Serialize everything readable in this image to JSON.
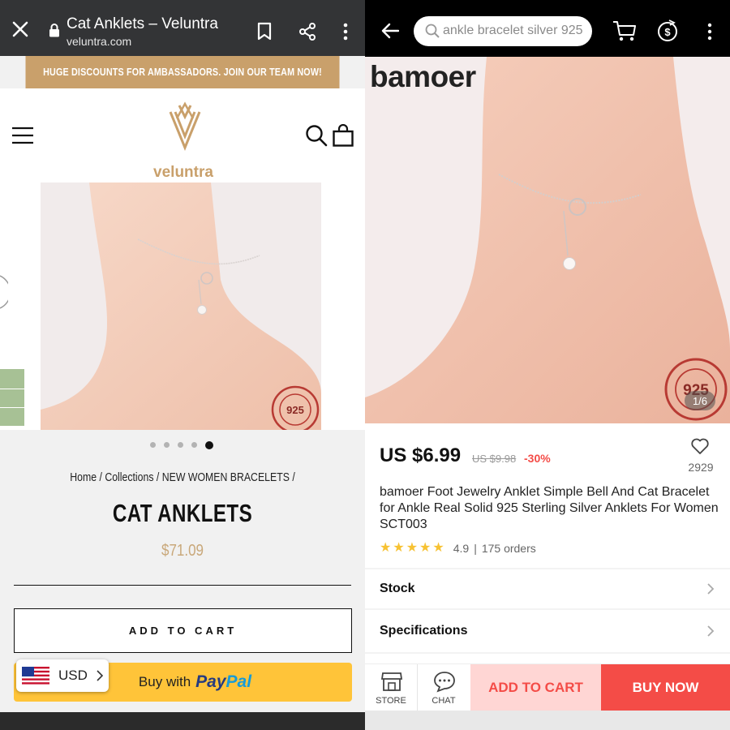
{
  "left": {
    "browser": {
      "page_title": "Cat Anklets – Veluntra",
      "url": "veluntra.com"
    },
    "banner": "HUGE DISCOUNTS FOR AMBASSADORS. JOIN OUR TEAM NOW!",
    "logo_text": "veluntra",
    "gallery": {
      "dots_total": 5,
      "active_dot": 5,
      "seal_text": "REAL STERLING 925 SILVER"
    },
    "breadcrumb": "Home / Collections / NEW WOMEN BRACELETS /",
    "product_title": "CAT ANKLETS",
    "price": "$71.09",
    "add_to_cart": "ADD TO CART",
    "paypal": {
      "prefix": "Buy with",
      "brand_part1": "Pay",
      "brand_part2": "Pal"
    },
    "currency": "USD",
    "accent_color": "#c9a06b"
  },
  "right": {
    "search_placeholder": "ankle bracelet silver 925",
    "brand": "bamoer",
    "image_counter": "1/6",
    "price": "US $6.99",
    "old_price": "US $9.98",
    "discount": "-30%",
    "wishlist_count": "2929",
    "description": "bamoer Foot Jewelry Anklet Simple Bell And Cat Bracelet for Ankle Real Solid 925 Sterling Silver Anklets For Women SCT003",
    "rating": "4.9",
    "orders": "175 orders",
    "rows": [
      "Stock",
      "Specifications"
    ],
    "bottom": {
      "store": "STORE",
      "chat": "CHAT",
      "add_to_cart": "ADD TO CART",
      "buy_now": "BUY NOW"
    },
    "accent_color": "#f44c47"
  }
}
